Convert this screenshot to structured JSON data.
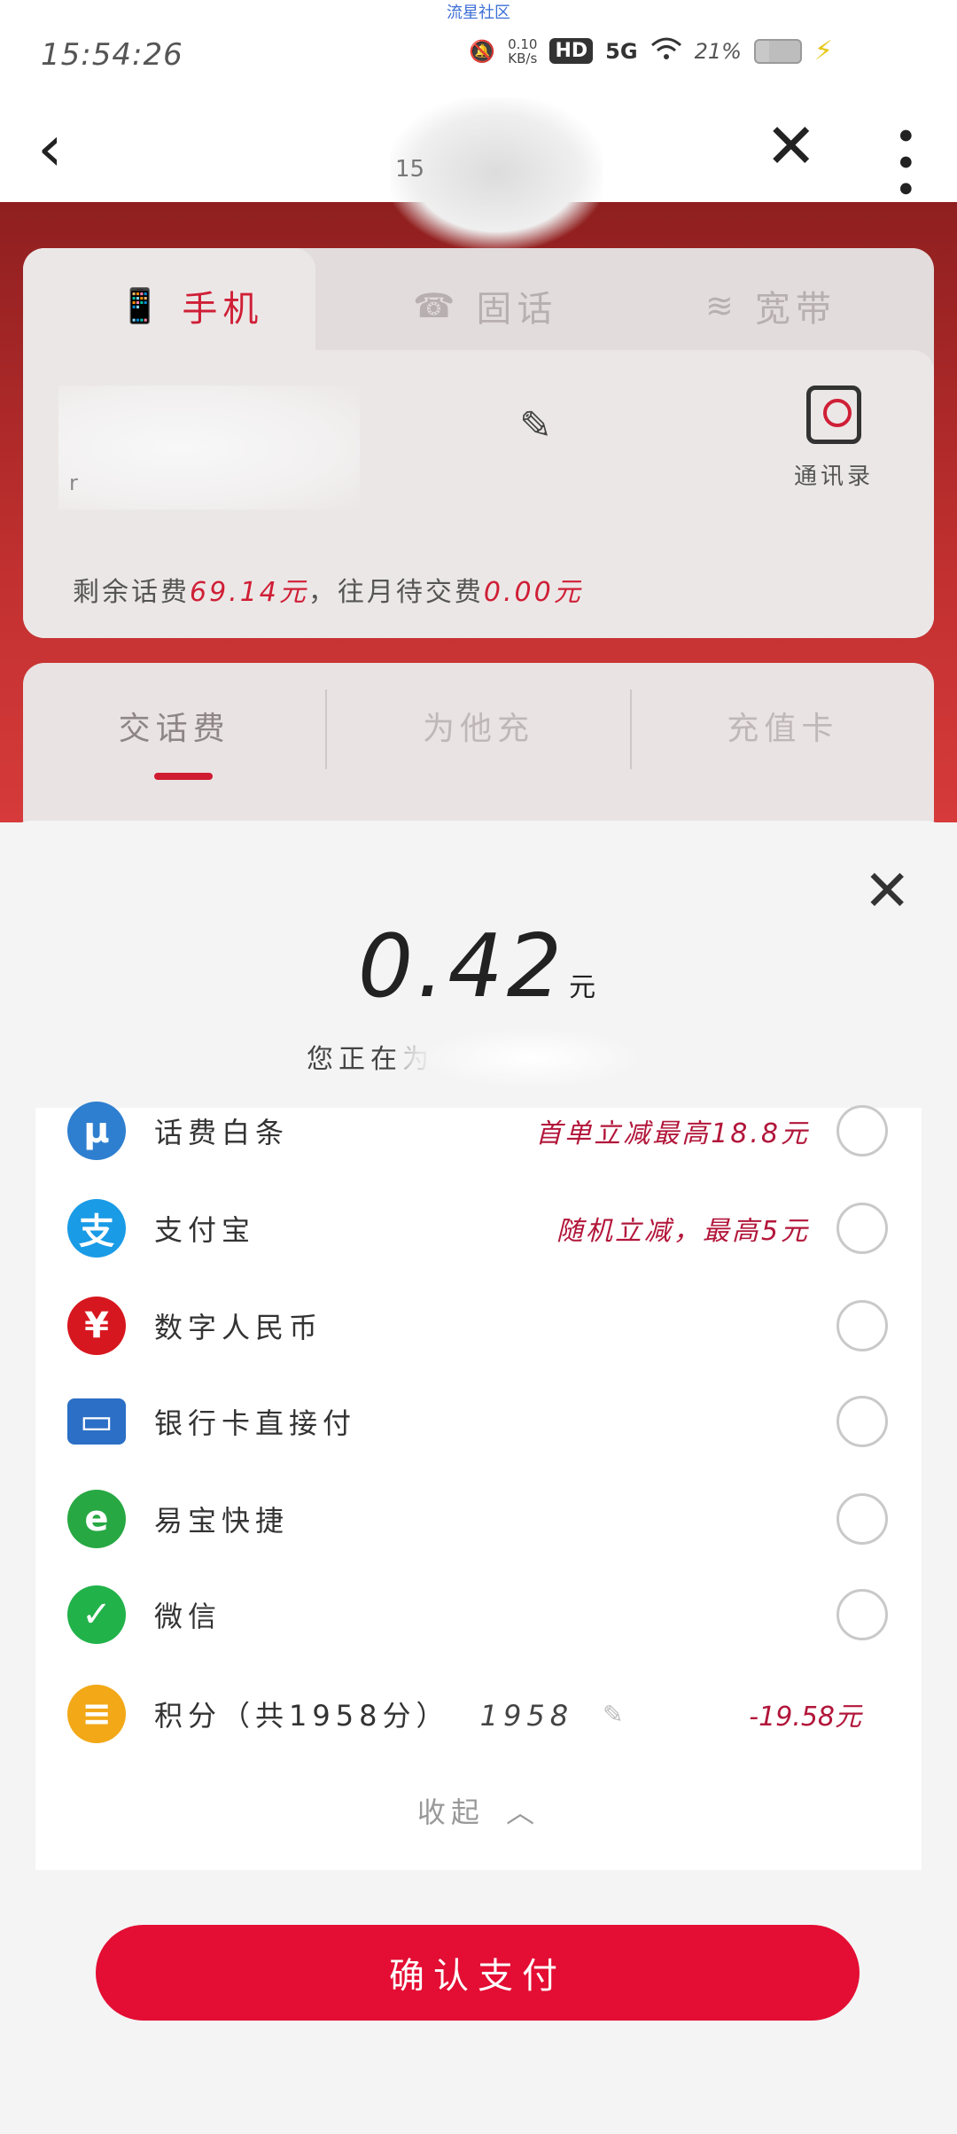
{
  "status_bar": {
    "top_label": "流星社区",
    "time": "15:54:26",
    "net_speed_value": "0.10",
    "net_speed_unit": "KB/s",
    "hd": "HD",
    "network": "5G",
    "battery": "21%"
  },
  "header": {
    "title_fragment": "15"
  },
  "service_tabs": [
    {
      "label": "手机",
      "icon": "mobile-phone-icon",
      "active": true
    },
    {
      "label": "固话",
      "icon": "telephone-icon",
      "active": false
    },
    {
      "label": "宽带",
      "icon": "broadband-icon",
      "active": false
    }
  ],
  "account": {
    "number_fragment": "r",
    "contacts_label": "通讯录",
    "balance_prefix": "剩余话费",
    "balance_amount": "69.14元",
    "balance_mid": "，往月待交费",
    "owed_amount": "0.00元"
  },
  "recharge_tabs": [
    {
      "label": "交话费",
      "active": true
    },
    {
      "label": "为他充",
      "active": false
    },
    {
      "label": "充值卡",
      "active": false
    }
  ],
  "payment_sheet": {
    "amount": "0.42",
    "unit": "元",
    "paying_for": "您正在为",
    "methods": [
      {
        "label": "话费白条",
        "icon": "mu-icon",
        "color": "#2f7fd0",
        "promo": "首单立减最高18.8元"
      },
      {
        "label": "支付宝",
        "icon": "alipay-icon",
        "color": "#1a9be6",
        "promo": "随机立减，最高5元"
      },
      {
        "label": "数字人民币",
        "icon": "digital-rmb-icon",
        "color": "#d7171f",
        "promo": ""
      },
      {
        "label": "银行卡直接付",
        "icon": "bank-card-icon",
        "color": "#2b6fc6",
        "promo": ""
      },
      {
        "label": "易宝快捷",
        "icon": "yeepay-icon",
        "color": "#27a843",
        "promo": ""
      },
      {
        "label": "微信",
        "icon": "wechat-icon",
        "color": "#22b24a",
        "promo": ""
      }
    ],
    "points": {
      "label": "积分（共1958分）",
      "value": "1958",
      "deduction": "-19.58元",
      "icon": "coins-icon",
      "color": "#f2a817"
    },
    "collapse_label": "收起",
    "confirm_label": "确认支付"
  }
}
